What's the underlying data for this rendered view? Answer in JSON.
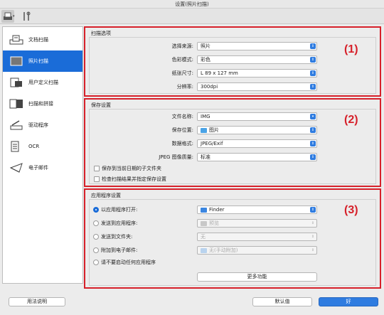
{
  "window": {
    "title": "设置(照片扫描)"
  },
  "toolbar": {
    "dropdown_indicator": "▾"
  },
  "sidebar": {
    "items": [
      {
        "label": "文档扫描"
      },
      {
        "label": "照片扫描"
      },
      {
        "label": "用户定义扫描"
      },
      {
        "label": "扫描和拼接"
      },
      {
        "label": "驱动程序"
      },
      {
        "label": "OCR"
      },
      {
        "label": "电子邮件"
      }
    ]
  },
  "scan_options": {
    "title": "扫描选项",
    "number": "(1)",
    "rows": [
      {
        "label": "选择来源:",
        "value": "照片"
      },
      {
        "label": "色彩模式:",
        "value": "彩色"
      },
      {
        "label": "纸张尺寸:",
        "value": "L 89 x 127 mm"
      },
      {
        "label": "分辨率:",
        "value": "300dpi"
      }
    ]
  },
  "save_settings": {
    "title": "保存设置",
    "number": "(2)",
    "file_name_label": "文件名称:",
    "file_name_value": "IMG",
    "save_in_label": "保存位置:",
    "save_in_value": "图片",
    "data_format_label": "数据格式:",
    "data_format_value": "JPEG/Exif",
    "jpeg_quality_label": "JPEG 图像质量:",
    "jpeg_quality_value": "标准",
    "checkbox_subfolder": "保存到当前日期的子文件夹",
    "checkbox_check_results": "检查扫描结果并指定保存设置"
  },
  "app_settings": {
    "title": "应用程序设置",
    "number": "(3)",
    "open_with_label": "以应用程序打开:",
    "open_with_value": "Finder",
    "send_to_app_label": "发送到应用程序:",
    "send_to_app_value": "预览",
    "send_to_folder_label": "发送到文件夹:",
    "send_to_folder_value": "无",
    "attach_email_label": "附加到电子邮件:",
    "attach_email_value": "无(手动附加)",
    "do_not_start_label": "请不要启动任何应用程序",
    "more_functions": "更多功能"
  },
  "footer": {
    "instructions": "用法说明",
    "defaults": "默认值",
    "ok": "好"
  },
  "colors": {
    "accent": "#1a6cd8",
    "highlight_frame": "#d6202a"
  }
}
